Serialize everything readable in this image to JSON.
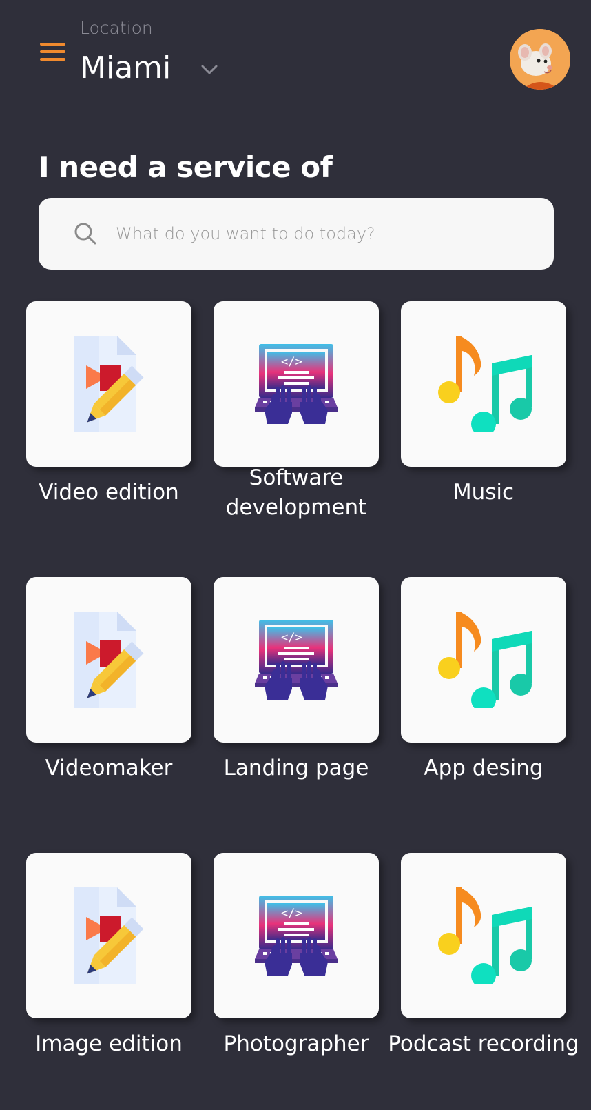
{
  "header": {
    "location_label": "Location",
    "location_value": "Miami"
  },
  "main": {
    "title": "I need a service of",
    "search_placeholder": "What do you want to do today?"
  },
  "services": [
    {
      "label": "Video edition",
      "icon": "video-edit-icon"
    },
    {
      "label": "Software development",
      "icon": "coding-laptop-icon"
    },
    {
      "label": "Music",
      "icon": "music-notes-icon"
    },
    {
      "label": "Videomaker",
      "icon": "video-edit-icon"
    },
    {
      "label": "Landing page",
      "icon": "coding-laptop-icon"
    },
    {
      "label": "App desing",
      "icon": "music-notes-icon"
    },
    {
      "label": "Image edition",
      "icon": "video-edit-icon"
    },
    {
      "label": "Photographer",
      "icon": "coding-laptop-icon"
    },
    {
      "label": "Podcast recording",
      "icon": "music-notes-icon"
    }
  ],
  "colors": {
    "background": "#2f2f3a",
    "accent": "#f08a2e",
    "tile": "#fafafa"
  }
}
